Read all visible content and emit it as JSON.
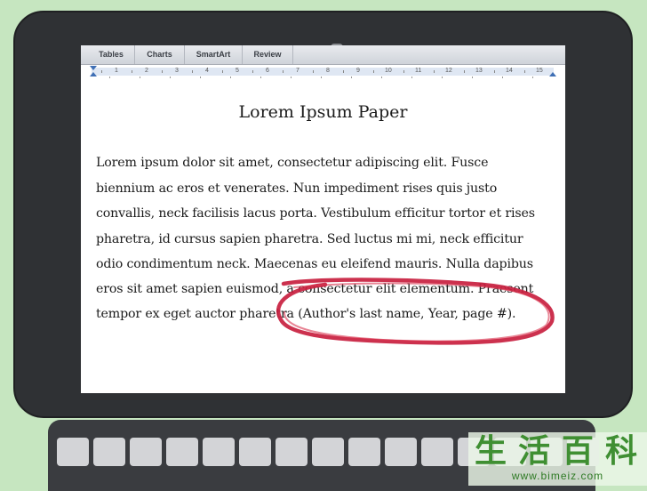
{
  "toolbar": {
    "tabs": [
      "Tables",
      "Charts",
      "SmartArt",
      "Review"
    ]
  },
  "ruler": {
    "numbers": [
      "1",
      "2",
      "3",
      "4",
      "5",
      "6",
      "7",
      "8",
      "9",
      "10",
      "11",
      "12",
      "13",
      "14",
      "15"
    ]
  },
  "document": {
    "title": "Lorem Ipsum Paper",
    "lines": [
      "Lorem ipsum dolor sit amet, consectetur adipiscing elit. Fusce",
      "biennium ac eros et venerates. Nun impediment rises quis justo",
      "convallis, neck facilisis lacus porta. Vestibulum efficitur tortor et rises",
      "pharetra, id cursus sapien pharetra. Sed luctus mi mi, neck efficitur",
      "odio condimentum neck. Maecenas eu eleifend mauris. Nulla dapibus",
      "eros sit amet sapien euismod, a consectetur elit elementum. Praesent",
      "tempor ex eget auctor pharetra (Author's last name, Year, page #)."
    ]
  },
  "annotation": {
    "color": "#c8203f"
  },
  "watermark": {
    "chars": [
      "生",
      "活",
      "百",
      "科"
    ],
    "url": "www.bimeiz.com"
  },
  "colors": {
    "background": "#c6e6c0",
    "laptop_body": "#2f3134",
    "ruler_marker": "#3f6fb5"
  }
}
